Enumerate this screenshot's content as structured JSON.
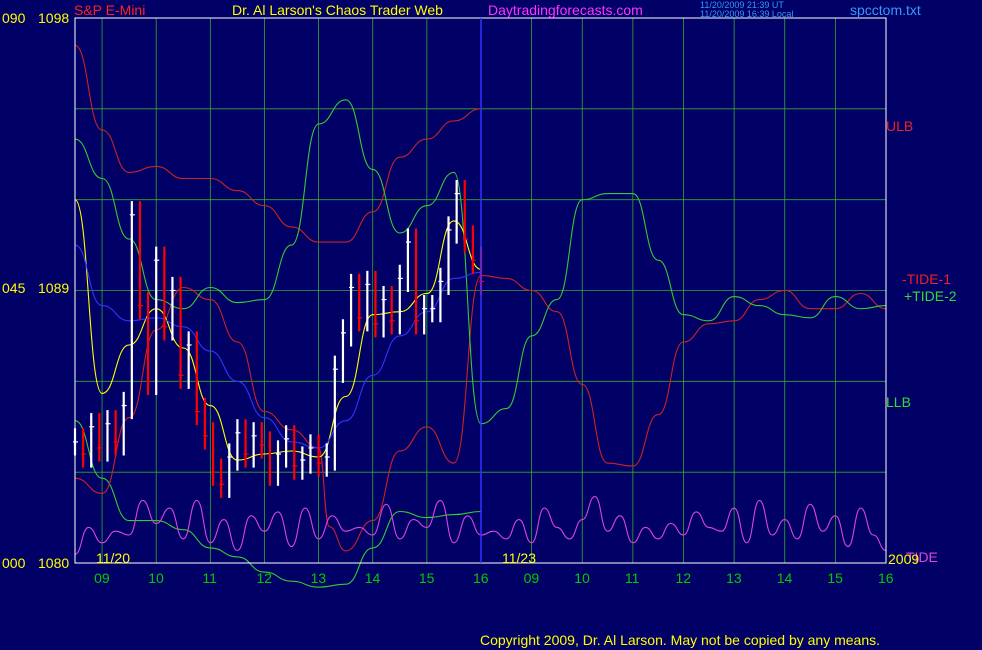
{
  "header": {
    "instrument": "S&P E-Mini",
    "title": "Dr. Al Larson's Chaos Trader Web",
    "site": "Daytradingforecasts.com",
    "timestamp_ut": "11/20/2009 21:39 UT",
    "timestamp_local": "11/20/2009 16:39 Local",
    "filename": "spcctom.txt"
  },
  "footer": {
    "copyright": "Copyright 2009, Dr. Al Larson. May not be copied by any means."
  },
  "colors": {
    "background": "#000066",
    "grid": "#33aa33",
    "price_down": "#ff0000",
    "price_up": "#ffffff",
    "ulb": "#cc2222",
    "llb": "#33cc33",
    "tide1": "#cc2222",
    "tide2": "#33cc33",
    "fast_ma": "#ffff00",
    "slow_ma": "#3333ff",
    "tide": "#dd44dd",
    "time_labels": "#00cc00",
    "scale_labels": "#ffff00",
    "frame": "#ffffff",
    "divider": "#3333ff"
  },
  "chart_data": {
    "type": "line",
    "title": "S&P E-Mini",
    "y_price_range": [
      1080,
      1098
    ],
    "y_index_range": [
      0,
      90
    ],
    "y_ticks": [
      {
        "index": "090",
        "price": "1098"
      },
      {
        "index": "045",
        "price": "1089"
      },
      {
        "index": "000",
        "price": "1080"
      }
    ],
    "x_hour_ticks": [
      "09",
      "10",
      "11",
      "12",
      "13",
      "14",
      "15",
      "16",
      "09",
      "10",
      "11",
      "12",
      "13",
      "14",
      "15",
      "16"
    ],
    "x_date_labels": {
      "day1": "11/20",
      "day2": "11/23",
      "year": "2009"
    },
    "right_labels": {
      "ulb": "ULB",
      "tide1": "-TIDE-1",
      "tide2": "+TIDE-2",
      "llb": "LLB",
      "tide": "TIDE"
    },
    "price_bars": {
      "time_hours": [
        8.5,
        8.65,
        8.8,
        8.95,
        9.1,
        9.25,
        9.4,
        9.55,
        9.7,
        9.85,
        10.0,
        10.15,
        10.3,
        10.45,
        10.6,
        10.75,
        10.9,
        11.05,
        11.2,
        11.35,
        11.5,
        11.65,
        11.8,
        11.95,
        12.1,
        12.25,
        12.4,
        12.55,
        12.7,
        12.85,
        13.0,
        13.15,
        13.3,
        13.45,
        13.6,
        13.75,
        13.9,
        14.05,
        14.2,
        14.35,
        14.5,
        14.65,
        14.8,
        14.95,
        15.1,
        15.25,
        15.4,
        15.55,
        15.7,
        15.85,
        16.0
      ],
      "close": [
        1084.0,
        1083.6,
        1084.5,
        1083.8,
        1084.6,
        1084.0,
        1085.2,
        1091.5,
        1088.5,
        1086.0,
        1090.0,
        1087.8,
        1089.0,
        1086.2,
        1087.2,
        1085.0,
        1084.2,
        1083.0,
        1082.6,
        1083.5,
        1084.3,
        1083.6,
        1084.2,
        1083.9,
        1083.0,
        1083.6,
        1084.1,
        1083.2,
        1083.4,
        1083.8,
        1083.3,
        1083.5,
        1086.4,
        1087.6,
        1089.1,
        1088.1,
        1089.2,
        1087.9,
        1088.7,
        1088.0,
        1089.4,
        1090.6,
        1088.0,
        1088.4,
        1088.4,
        1089.3,
        1091.0,
        1092.2,
        1090.7,
        1090.0,
        1089.3
      ]
    },
    "series": [
      {
        "name": "ULB",
        "time_hours": [
          8.5,
          9.0,
          9.5,
          10.0,
          10.5,
          11.0,
          11.5,
          12.0,
          12.5,
          13.0,
          13.5,
          14.0,
          14.5,
          15.0,
          15.5,
          16.0
        ],
        "values": [
          1097.1,
          1094.3,
          1092.9,
          1093.1,
          1092.7,
          1092.7,
          1092.3,
          1091.8,
          1091.1,
          1090.6,
          1090.6,
          1091.6,
          1093.4,
          1094.0,
          1094.6,
          1095.0
        ]
      },
      {
        "name": "LLB",
        "time_hours": [
          8.5,
          9.0,
          9.5,
          10.0,
          10.5,
          11.0,
          11.5,
          12.0,
          12.5,
          13.0,
          13.5,
          14.0,
          14.5,
          15.0,
          15.5,
          16.0
        ],
        "values": [
          1084.7,
          1082.8,
          1081.4,
          1081.4,
          1081.1,
          1080.5,
          1080.2,
          1079.7,
          1079.4,
          1079.2,
          1079.3,
          1080.5,
          1081.7,
          1081.5,
          1081.6,
          1081.7
        ]
      },
      {
        "name": "-TIDE-1",
        "time_hours": [
          8.5,
          9.0,
          9.5,
          10.0,
          10.5,
          11.0,
          11.5,
          12.0,
          12.5,
          13.0,
          13.2,
          13.5,
          14.0,
          14.5,
          15.0,
          15.5,
          16.0,
          16.5,
          17.0,
          17.5,
          18.0,
          18.5,
          19.0,
          19.5,
          20.0,
          20.5,
          21.0,
          21.5,
          22.0,
          22.5,
          23.0,
          23.5,
          24.0
        ],
        "values": [
          1082.8,
          1082.3,
          1084.8,
          1087.7,
          1089.1,
          1088.7,
          1087.3,
          1085.0,
          1084.4,
          1083.8,
          1081.2,
          1080.4,
          1081.4,
          1083.7,
          1084.5,
          1083.3,
          1089.5,
          1089.4,
          1089.0,
          1088.3,
          1085.9,
          1083.3,
          1083.2,
          1084.9,
          1087.3,
          1087.9,
          1088.0,
          1088.7,
          1089.0,
          1088.4,
          1088.4,
          1088.9,
          1088.4
        ]
      },
      {
        "name": "+TIDE-2",
        "time_hours": [
          8.5,
          9.0,
          9.5,
          10.0,
          10.5,
          11.0,
          11.5,
          12.0,
          12.5,
          13.0,
          13.5,
          14.0,
          14.5,
          15.0,
          15.5,
          16.0,
          16.5,
          17.0,
          17.5,
          18.0,
          18.5,
          19.0,
          19.5,
          20.0,
          20.5,
          21.0,
          21.5,
          22.0,
          22.5,
          23.0,
          23.5,
          24.0
        ],
        "values": [
          1094.0,
          1092.7,
          1090.7,
          1088.7,
          1088.4,
          1089.1,
          1088.6,
          1088.7,
          1090.5,
          1094.5,
          1095.3,
          1093.0,
          1090.9,
          1091.8,
          1092.9,
          1084.6,
          1085.1,
          1087.5,
          1088.7,
          1092.0,
          1092.2,
          1092.2,
          1090.0,
          1088.2,
          1088.0,
          1088.8,
          1088.5,
          1088.2,
          1088.1,
          1088.8,
          1088.4,
          1088.5
        ]
      },
      {
        "name": "Fast MA",
        "time_hours": [
          8.5,
          9.0,
          9.5,
          10.0,
          10.5,
          11.0,
          11.5,
          12.0,
          12.5,
          13.0,
          13.5,
          14.0,
          14.5,
          15.0,
          15.5,
          16.0
        ],
        "values": [
          1092.0,
          1085.6,
          1087.2,
          1088.4,
          1087.1,
          1085.2,
          1083.4,
          1083.6,
          1083.7,
          1083.5,
          1085.5,
          1088.2,
          1088.3,
          1088.9,
          1091.3,
          1089.7
        ]
      },
      {
        "name": "Slow MA",
        "time_hours": [
          8.5,
          9.0,
          9.5,
          10.0,
          10.5,
          11.0,
          11.5,
          12.0,
          12.5,
          13.0,
          13.5,
          14.0,
          14.5,
          15.0,
          15.5,
          16.0
        ],
        "values": [
          1090.5,
          1088.5,
          1088.0,
          1088.1,
          1087.8,
          1087.0,
          1086.0,
          1084.8,
          1084.0,
          1083.8,
          1084.7,
          1086.2,
          1087.5,
          1088.3,
          1089.4,
          1089.6
        ]
      }
    ],
    "tide_oscillator": {
      "range": [
        0,
        100
      ],
      "time_hours": [
        8.5,
        8.75,
        9.0,
        9.25,
        9.5,
        9.75,
        10.0,
        10.25,
        10.5,
        10.75,
        11.0,
        11.25,
        11.5,
        11.75,
        12.0,
        12.25,
        12.5,
        12.75,
        13.0,
        13.25,
        13.5,
        13.75,
        14.0,
        14.25,
        14.5,
        14.75,
        15.0,
        15.25,
        15.5,
        15.75,
        16.0,
        16.25,
        16.5,
        16.75,
        17.0,
        17.25,
        17.5,
        17.75,
        18.0,
        18.25,
        18.5,
        18.75,
        19.0,
        19.25,
        19.5,
        19.75,
        20.0,
        20.25,
        20.5,
        20.75,
        21.0,
        21.25,
        21.5,
        21.75,
        22.0,
        22.25,
        22.5,
        22.75,
        23.0,
        23.25,
        23.5,
        23.75,
        24.0
      ],
      "values": [
        10,
        45,
        25,
        40,
        35,
        80,
        50,
        70,
        30,
        80,
        25,
        55,
        15,
        60,
        40,
        65,
        20,
        70,
        30,
        60,
        40,
        45,
        35,
        75,
        30,
        55,
        45,
        80,
        25,
        60,
        35,
        40,
        30,
        55,
        25,
        70,
        45,
        30,
        55,
        85,
        40,
        60,
        25,
        45,
        30,
        50,
        35,
        65,
        45,
        40,
        70,
        25,
        80,
        35,
        55,
        30,
        75,
        40,
        60,
        20,
        70,
        35,
        15
      ]
    }
  }
}
